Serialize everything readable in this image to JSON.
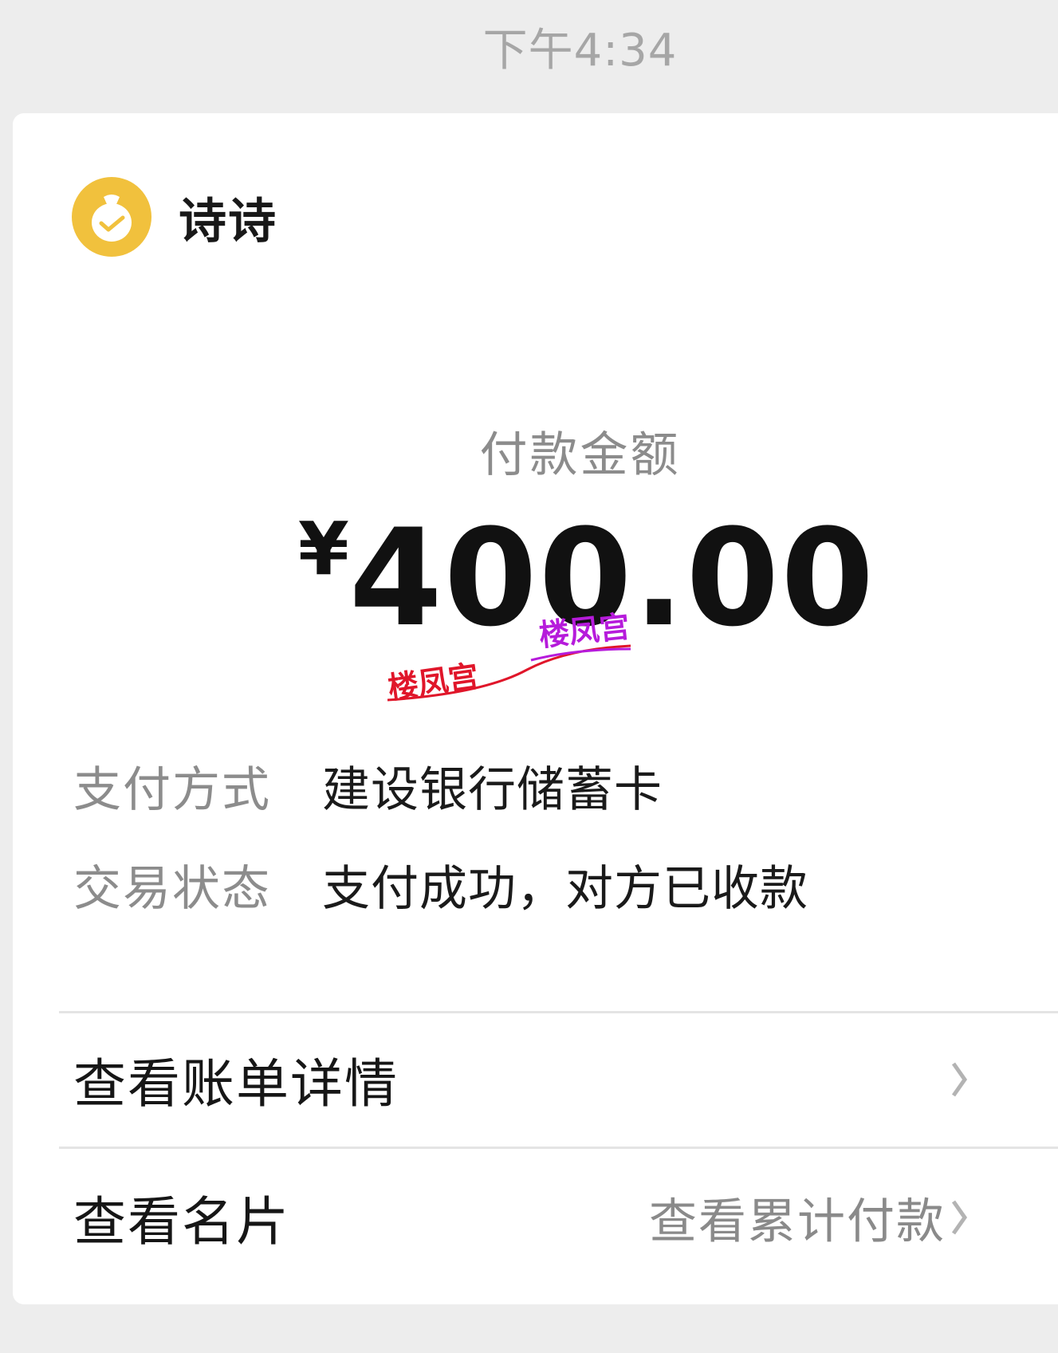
{
  "chat": {
    "timestamp": "下午4:34"
  },
  "payment_card": {
    "payer_name": "诗诗",
    "avatar_icon": "money-bag-icon",
    "avatar_color": "#f1c13d",
    "amount_label": "付款金额",
    "currency_symbol": "¥",
    "amount_value": "400.00",
    "details": [
      {
        "label": "支付方式",
        "value": "建设银行储蓄卡"
      },
      {
        "label": "交易状态",
        "value": "支付成功，对方已收款"
      }
    ],
    "links": {
      "bill_details": "查看账单详情",
      "business_card": "查看名片",
      "cumulative_payments": "查看累计付款"
    }
  },
  "watermark": {
    "text_1": "楼凤宫",
    "text_2": "楼凤宫",
    "color_1": "#e0162a",
    "color_2": "#b61bdb"
  }
}
